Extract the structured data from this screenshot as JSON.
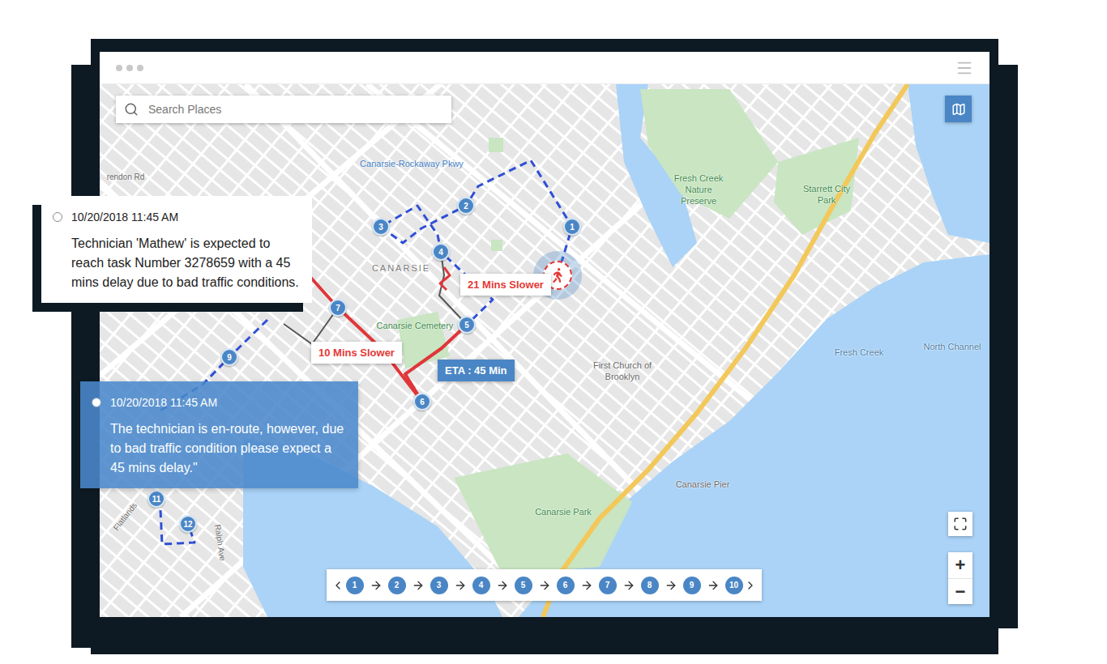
{
  "search": {
    "placeholder": "Search Places"
  },
  "map": {
    "labels": [
      {
        "text": "Canarsie-Rockaway Pkwy",
        "kind": "transit"
      },
      {
        "text": "CANARSIE",
        "kind": "district"
      },
      {
        "text": "Canarsie Cemetery",
        "kind": "park"
      },
      {
        "text": "Fresh Creek Nature Preserve",
        "kind": "park"
      },
      {
        "text": "Starrett City Park",
        "kind": "park"
      },
      {
        "text": "First Church of Brooklyn",
        "kind": "place"
      },
      {
        "text": "Fresh Creek",
        "kind": "water"
      },
      {
        "text": "North Channel",
        "kind": "water"
      },
      {
        "text": "Canarsie Pier",
        "kind": "place"
      },
      {
        "text": "Canarsie Park",
        "kind": "park"
      },
      {
        "text": "rendon Rd",
        "kind": "street"
      },
      {
        "text": "Ralph Ave",
        "kind": "street"
      },
      {
        "text": "Flatlands",
        "kind": "street"
      }
    ],
    "markers": [
      {
        "label": "1"
      },
      {
        "label": "2"
      },
      {
        "label": "3"
      },
      {
        "label": "4"
      },
      {
        "label": "5"
      },
      {
        "label": "6"
      },
      {
        "label": "7"
      },
      {
        "label": "9"
      },
      {
        "label": "11"
      },
      {
        "label": "12"
      }
    ],
    "badges": [
      {
        "text": "21 Mins Slower",
        "kind": "delay"
      },
      {
        "text": "10 Mins Slower",
        "kind": "delay"
      },
      {
        "text": "ETA : 45 Min",
        "kind": "eta"
      }
    ]
  },
  "controls": {
    "zoom_in": "+",
    "zoom_out": "−"
  },
  "stepper": {
    "steps": [
      "1",
      "2",
      "3",
      "4",
      "5",
      "6",
      "7",
      "8",
      "9",
      "10"
    ]
  },
  "notifications": [
    {
      "time": "10/20/2018 11:45 AM",
      "message": "Technician 'Mathew' is expected to reach task Number 3278659 with a 45 mins delay due to bad traffic conditions.",
      "selected": false
    },
    {
      "time": "10/20/2018 11:45 AM",
      "message": "The technician is en-route, however, due to bad traffic condition please expect a 45 mins delay.\"",
      "selected": true
    }
  ]
}
